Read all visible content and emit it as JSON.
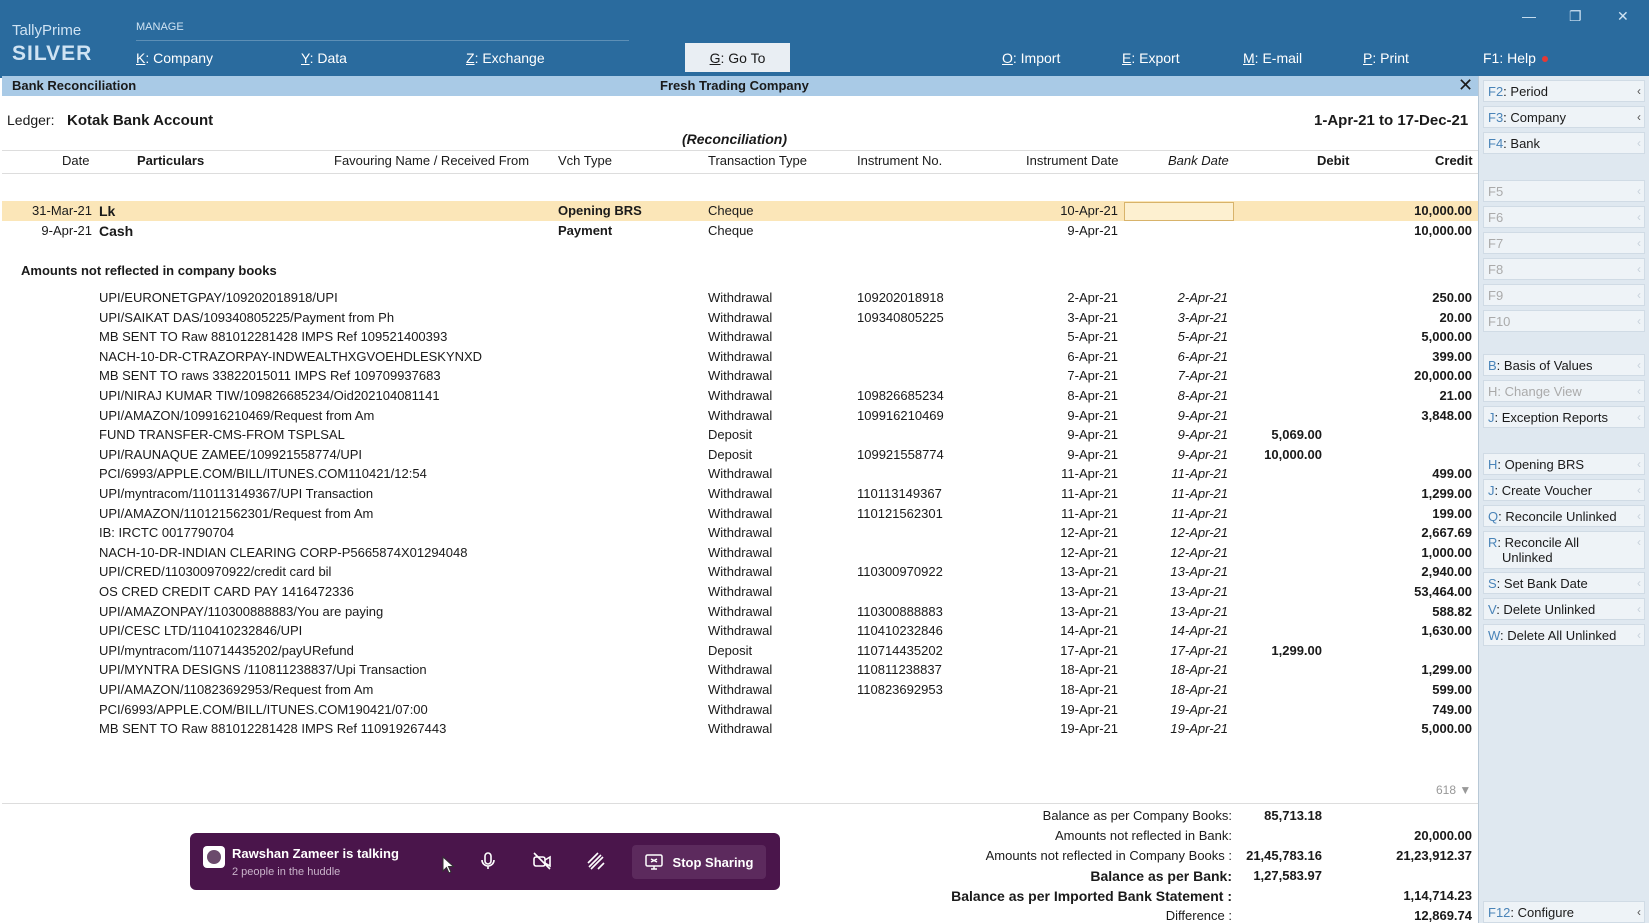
{
  "app": {
    "brand_name": "TallyPrime",
    "edition": "SILVER",
    "manage_label": "MANAGE"
  },
  "menu": [
    {
      "key": "K",
      "label": ": Company"
    },
    {
      "key": "Y",
      "label": ": Data"
    },
    {
      "key": "Z",
      "label": ": Exchange"
    },
    {
      "key": "G",
      "label": ": Go To"
    },
    {
      "key": "O",
      "label": ": Import"
    },
    {
      "key": "E",
      "label": ": Export"
    },
    {
      "key": "M",
      "label": ": E-mail"
    },
    {
      "key": "P",
      "label": ": Print"
    },
    {
      "key": "F1",
      "label": ": Help"
    }
  ],
  "window_controls": {
    "minimize": "—",
    "restore": "❐",
    "close": "✕"
  },
  "titlebar": {
    "screen": "Bank Reconciliation",
    "company": "Fresh Trading Company",
    "close": "✕"
  },
  "report": {
    "ledger_label": "Ledger:",
    "ledger_name": "Kotak Bank Account",
    "period": "1-Apr-21 to 17-Dec-21",
    "subtitle": "(Reconciliation)"
  },
  "columns": [
    "Date",
    "Particulars",
    "Favouring Name / Received From",
    "Vch Type",
    "Transaction Type",
    "Instrument No.",
    "Instrument Date",
    "Bank Date",
    "Debit",
    "Credit"
  ],
  "vouchers": [
    {
      "date": "31-Mar-21",
      "particulars": "Lk",
      "vch_type": "Opening BRS",
      "txn_type": "Cheque",
      "inst_date": "10-Apr-21",
      "credit": "10,000.00"
    },
    {
      "date": "9-Apr-21",
      "particulars": "Cash",
      "vch_type": "Payment",
      "txn_type": "Cheque",
      "inst_date": "9-Apr-21",
      "credit": "10,000.00"
    }
  ],
  "section_title": "Amounts not reflected in company books",
  "entries": [
    {
      "particulars": "UPI/EURONETGPAY/109202018918/UPI",
      "txn": "Withdrawal",
      "inst_no": "109202018918",
      "inst_date": "2-Apr-21",
      "bank_date": "2-Apr-21",
      "debit": "",
      "credit": "250.00"
    },
    {
      "particulars": "UPI/SAIKAT DAS/109340805225/Payment from Ph",
      "txn": "Withdrawal",
      "inst_no": "109340805225",
      "inst_date": "3-Apr-21",
      "bank_date": "3-Apr-21",
      "debit": "",
      "credit": "20.00"
    },
    {
      "particulars": "MB SENT TO Raw 881012281428 IMPS Ref 109521400393",
      "txn": "Withdrawal",
      "inst_no": "",
      "inst_date": "5-Apr-21",
      "bank_date": "5-Apr-21",
      "debit": "",
      "credit": "5,000.00"
    },
    {
      "particulars": "NACH-10-DR-CTRAZORPAY-INDWEALTHXGVOEHDLESKYNXD",
      "txn": "Withdrawal",
      "inst_no": "",
      "inst_date": "6-Apr-21",
      "bank_date": "6-Apr-21",
      "debit": "",
      "credit": "399.00"
    },
    {
      "particulars": "MB SENT TO raws 33822015011 IMPS Ref 109709937683",
      "txn": "Withdrawal",
      "inst_no": "",
      "inst_date": "7-Apr-21",
      "bank_date": "7-Apr-21",
      "debit": "",
      "credit": "20,000.00"
    },
    {
      "particulars": "UPI/NIRAJ KUMAR TIW/109826685234/Oid202104081141",
      "txn": "Withdrawal",
      "inst_no": "109826685234",
      "inst_date": "8-Apr-21",
      "bank_date": "8-Apr-21",
      "debit": "",
      "credit": "21.00"
    },
    {
      "particulars": "UPI/AMAZON/109916210469/Request from Am",
      "txn": "Withdrawal",
      "inst_no": "109916210469",
      "inst_date": "9-Apr-21",
      "bank_date": "9-Apr-21",
      "debit": "",
      "credit": "3,848.00"
    },
    {
      "particulars": "FUND TRANSFER-CMS-FROM TSPLSAL",
      "txn": "Deposit",
      "inst_no": "",
      "inst_date": "9-Apr-21",
      "bank_date": "9-Apr-21",
      "debit": "5,069.00",
      "credit": ""
    },
    {
      "particulars": "UPI/RAUNAQUE  ZAMEE/109921558774/UPI",
      "txn": "Deposit",
      "inst_no": "109921558774",
      "inst_date": "9-Apr-21",
      "bank_date": "9-Apr-21",
      "debit": "10,000.00",
      "credit": ""
    },
    {
      "particulars": "PCI/6993/APPLE.COM/BILL/ITUNES.COM110421/12:54",
      "txn": "Withdrawal",
      "inst_no": "",
      "inst_date": "11-Apr-21",
      "bank_date": "11-Apr-21",
      "debit": "",
      "credit": "499.00"
    },
    {
      "particulars": "UPI/myntracom/110113149367/UPI Transaction",
      "txn": "Withdrawal",
      "inst_no": "110113149367",
      "inst_date": "11-Apr-21",
      "bank_date": "11-Apr-21",
      "debit": "",
      "credit": "1,299.00"
    },
    {
      "particulars": "UPI/AMAZON/110121562301/Request from Am",
      "txn": "Withdrawal",
      "inst_no": "110121562301",
      "inst_date": "11-Apr-21",
      "bank_date": "11-Apr-21",
      "debit": "",
      "credit": "199.00"
    },
    {
      "particulars": "IB: IRCTC 0017790704",
      "txn": "Withdrawal",
      "inst_no": "",
      "inst_date": "12-Apr-21",
      "bank_date": "12-Apr-21",
      "debit": "",
      "credit": "2,667.69"
    },
    {
      "particulars": "NACH-10-DR-INDIAN CLEARING CORP-P5665874X01294048",
      "txn": "Withdrawal",
      "inst_no": "",
      "inst_date": "12-Apr-21",
      "bank_date": "12-Apr-21",
      "debit": "",
      "credit": "1,000.00"
    },
    {
      "particulars": "UPI/CRED/110300970922/credit card bil",
      "txn": "Withdrawal",
      "inst_no": "110300970922",
      "inst_date": "13-Apr-21",
      "bank_date": "13-Apr-21",
      "debit": "",
      "credit": "2,940.00"
    },
    {
      "particulars": "OS CRED CREDIT CARD PAY 1416472336",
      "txn": "Withdrawal",
      "inst_no": "",
      "inst_date": "13-Apr-21",
      "bank_date": "13-Apr-21",
      "debit": "",
      "credit": "53,464.00"
    },
    {
      "particulars": "UPI/AMAZONPAY/110300888883/You are paying",
      "txn": "Withdrawal",
      "inst_no": "110300888883",
      "inst_date": "13-Apr-21",
      "bank_date": "13-Apr-21",
      "debit": "",
      "credit": "588.82"
    },
    {
      "particulars": "UPI/CESC LTD/110410232846/UPI",
      "txn": "Withdrawal",
      "inst_no": "110410232846",
      "inst_date": "14-Apr-21",
      "bank_date": "14-Apr-21",
      "debit": "",
      "credit": "1,630.00"
    },
    {
      "particulars": "UPI/myntracom/110714435202/payURefund",
      "txn": "Deposit",
      "inst_no": "110714435202",
      "inst_date": "17-Apr-21",
      "bank_date": "17-Apr-21",
      "debit": "1,299.00",
      "credit": ""
    },
    {
      "particulars": "UPI/MYNTRA DESIGNS /110811238837/Upi Transaction",
      "txn": "Withdrawal",
      "inst_no": "110811238837",
      "inst_date": "18-Apr-21",
      "bank_date": "18-Apr-21",
      "debit": "",
      "credit": "1,299.00"
    },
    {
      "particulars": "UPI/AMAZON/110823692953/Request from Am",
      "txn": "Withdrawal",
      "inst_no": "110823692953",
      "inst_date": "18-Apr-21",
      "bank_date": "18-Apr-21",
      "debit": "",
      "credit": "599.00"
    },
    {
      "particulars": "PCI/6993/APPLE.COM/BILL/ITUNES.COM190421/07:00",
      "txn": "Withdrawal",
      "inst_no": "",
      "inst_date": "19-Apr-21",
      "bank_date": "19-Apr-21",
      "debit": "",
      "credit": "749.00"
    },
    {
      "particulars": "MB SENT TO Raw 881012281428 IMPS Ref 110919267443",
      "txn": "Withdrawal",
      "inst_no": "",
      "inst_date": "19-Apr-21",
      "bank_date": "19-Apr-21",
      "debit": "",
      "credit": "5,000.00"
    }
  ],
  "scroll_count": "618 ▼",
  "summary": [
    {
      "label": "Balance as per Company Books:",
      "debit": "85,713.18",
      "credit": "",
      "bold": false
    },
    {
      "label": "Amounts not reflected in Bank:",
      "debit": "",
      "credit": "20,000.00",
      "bold": false
    },
    {
      "label": "Amounts not reflected in Company Books :",
      "debit": "21,45,783.16",
      "credit": "21,23,912.37",
      "bold": false
    },
    {
      "label": "Balance as per Bank:",
      "debit": "1,27,583.97",
      "credit": "",
      "bold": true
    },
    {
      "label": "Balance as per Imported Bank Statement :",
      "debit": "",
      "credit": "1,14,714.23",
      "bold": true
    },
    {
      "label": "Difference :",
      "debit": "",
      "credit": "12,869.74",
      "bold": false
    }
  ],
  "sidebar": {
    "top": [
      {
        "key": "F2",
        "label": ": Period",
        "enabled": true
      },
      {
        "key": "F3",
        "label": ": Company",
        "enabled": true
      },
      {
        "key": "F4",
        "label": ": Bank",
        "enabled": true
      }
    ],
    "fkeys": [
      "F5",
      "F6",
      "F7",
      "F8",
      "F9",
      "F10"
    ],
    "group1": [
      {
        "key": "B",
        "label": ": Basis of Values",
        "enabled": true
      },
      {
        "key": "H",
        "label": ": Change View",
        "enabled": false
      },
      {
        "key": "J",
        "label": ": Exception Reports",
        "enabled": true
      }
    ],
    "group2": [
      {
        "key": "H",
        "label": ": Opening BRS"
      },
      {
        "key": "J",
        "label": ": Create Voucher"
      },
      {
        "key": "Q",
        "label": ": Reconcile Unlinked"
      },
      {
        "key": "R",
        "label": ": Reconcile All",
        "label2": "Unlinked"
      },
      {
        "key": "S",
        "label": ": Set Bank Date"
      },
      {
        "key": "V",
        "label": ": Delete Unlinked"
      },
      {
        "key": "W",
        "label": ": Delete All Unlinked"
      }
    ],
    "bottom": {
      "key": "F12",
      "label": ": Configure"
    }
  },
  "huddle": {
    "title": "Rawshan Zameer is talking",
    "subtitle": "2 people in the huddle",
    "icons": [
      "microphone-icon",
      "video-off-icon",
      "screen-draw-icon"
    ],
    "stop_label": "Stop Sharing"
  },
  "colors": {
    "topbar": "#2a6b9e",
    "titlebar": "#a9cae6",
    "highlight_row": "#fbe6b8",
    "huddle": "#4a154b"
  }
}
